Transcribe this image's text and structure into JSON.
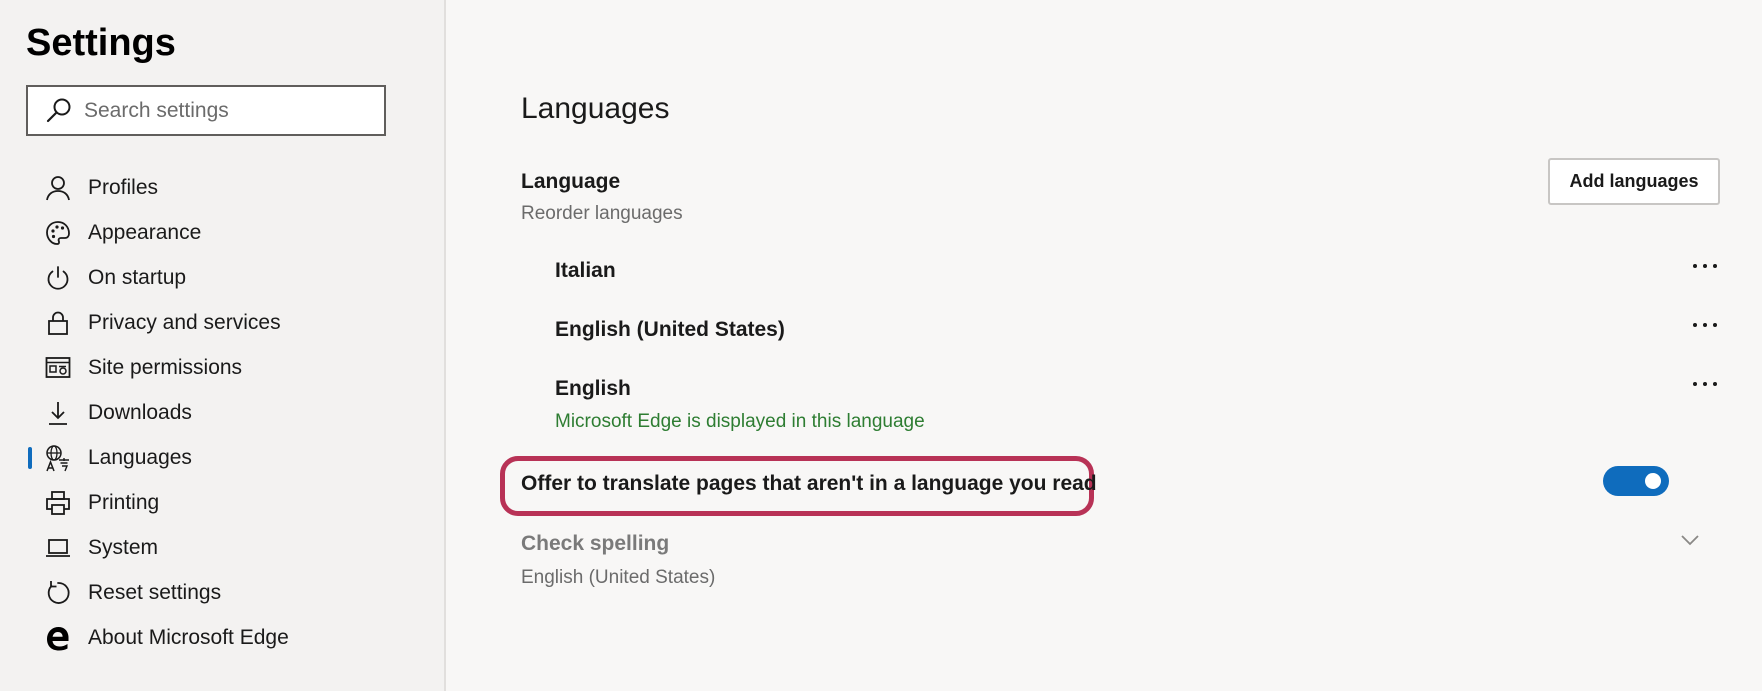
{
  "sidebar": {
    "title": "Settings",
    "search_placeholder": "Search settings",
    "items": [
      {
        "label": "Profiles",
        "icon": "person-icon"
      },
      {
        "label": "Appearance",
        "icon": "palette-icon"
      },
      {
        "label": "On startup",
        "icon": "power-icon"
      },
      {
        "label": "Privacy and services",
        "icon": "lock-icon"
      },
      {
        "label": "Site permissions",
        "icon": "site-permissions-icon"
      },
      {
        "label": "Downloads",
        "icon": "download-icon"
      },
      {
        "label": "Languages",
        "icon": "languages-icon",
        "active": true
      },
      {
        "label": "Printing",
        "icon": "printer-icon"
      },
      {
        "label": "System",
        "icon": "laptop-icon"
      },
      {
        "label": "Reset settings",
        "icon": "reset-icon"
      },
      {
        "label": "About Microsoft Edge",
        "icon": "edge-logo-icon"
      }
    ]
  },
  "main": {
    "title": "Languages",
    "language": {
      "label": "Language",
      "sub": "Reorder languages",
      "add_button": "Add languages",
      "items": [
        {
          "name": "Italian",
          "note": ""
        },
        {
          "name": "English (United States)",
          "note": ""
        },
        {
          "name": "English",
          "note": "Microsoft Edge is displayed in this language"
        }
      ]
    },
    "translate": {
      "label": "Offer to translate pages that aren't in a language you read",
      "enabled": true
    },
    "spelling": {
      "label": "Check spelling",
      "sub": "English (United States)"
    }
  },
  "colors": {
    "accent": "#0f6cbd",
    "highlight": "#b83256",
    "note_green": "#2e7d32"
  }
}
